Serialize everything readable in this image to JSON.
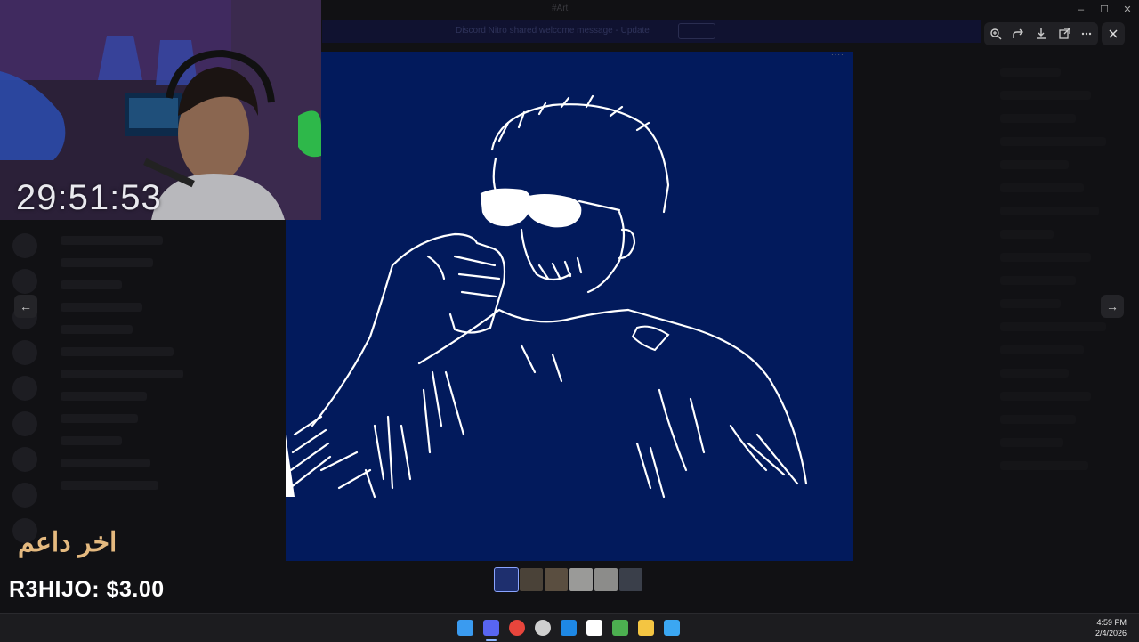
{
  "window": {
    "title": "#Art"
  },
  "background": {
    "banner_text": "Discord Nitro shared welcome message - Update",
    "banner_button": "Update"
  },
  "viewer": {
    "toolbar": [
      {
        "name": "zoom-in-icon",
        "glyph": "+"
      },
      {
        "name": "forward-icon",
        "glyph": "↪"
      },
      {
        "name": "download-icon",
        "glyph": "⤓"
      },
      {
        "name": "open-external-icon",
        "glyph": "⧉"
      },
      {
        "name": "more-icon",
        "glyph": "⋯"
      }
    ],
    "close_glyph": "✕",
    "prev_glyph": "←",
    "next_glyph": "→",
    "image_background": "#021a5c",
    "thumbnails": [
      "#1e2f6e",
      "#4a4238",
      "#5a4e40",
      "#9a9a98",
      "#8c8c8a",
      "#3a3f4a"
    ]
  },
  "overlay": {
    "timer": "29:51:53",
    "donation_label": "اخر داعم",
    "donation_amount": "R3HIJO: $3.00"
  },
  "taskbar": {
    "time": "4:59 PM",
    "date": "2/4/2026",
    "icons": [
      {
        "name": "windows-start-icon",
        "color": "#3a9bf0"
      },
      {
        "name": "discord-icon",
        "color": "#5865f2"
      },
      {
        "name": "chrome-icon",
        "color": "#e8453c"
      },
      {
        "name": "obs-icon",
        "color": "#cfcfcf"
      },
      {
        "name": "edge-icon",
        "color": "#1e88e5"
      },
      {
        "name": "app-icon",
        "color": "#ffffff"
      },
      {
        "name": "minecraft-icon",
        "color": "#4caf50"
      },
      {
        "name": "file-explorer-icon",
        "color": "#f4c542"
      },
      {
        "name": "photos-icon",
        "color": "#3ba7f2"
      }
    ]
  }
}
